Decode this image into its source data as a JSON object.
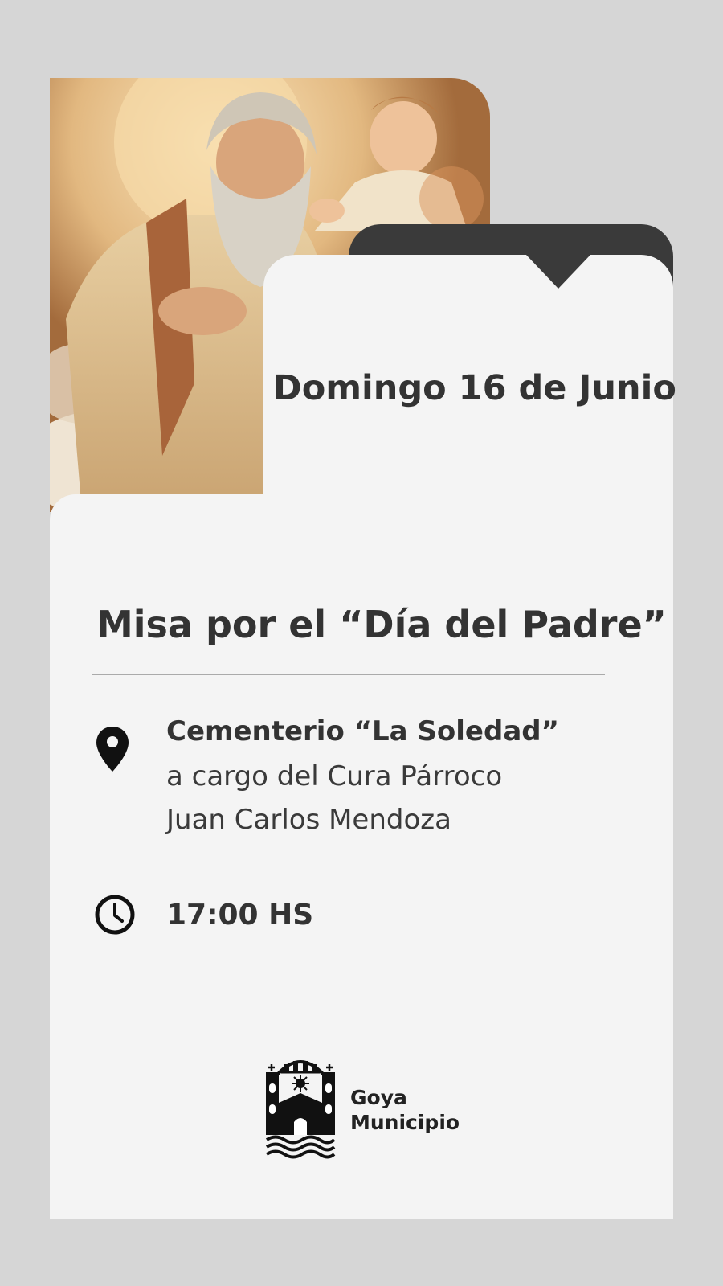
{
  "event": {
    "date": "Domingo 16 de Junio",
    "title": "Misa por el “Día del Padre”",
    "location": {
      "name": "Cementerio “La Soledad”",
      "line1": "a cargo del Cura Párroco",
      "line2": "Juan Carlos Mendoza",
      "icon": "location-pin-icon"
    },
    "time": {
      "value": "17:00 HS",
      "icon": "clock-icon"
    }
  },
  "organizer": {
    "name_line1": "Goya",
    "name_line2": "Municipio",
    "logo": "cathedral-logo"
  },
  "colors": {
    "page_background": "#d6d6d6",
    "card": "#f4f4f4",
    "dark_accent": "#3a3a3a",
    "text": "#333333"
  }
}
